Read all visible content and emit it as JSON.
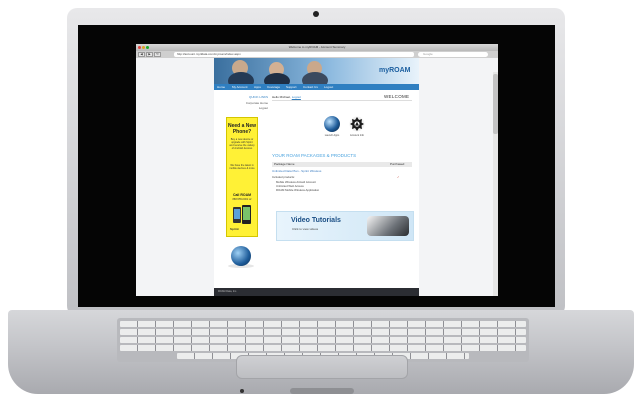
{
  "browser": {
    "window_title": "Welcome to myROAM - Account Summary",
    "url": "http://account.myrldata.com/myroam/index.aspx",
    "search_placeholder": "Google",
    "nav_back": "◀",
    "nav_forward": "▶",
    "nav_reload": "↻"
  },
  "site": {
    "logo": "myROAM",
    "nav": [
      "Home",
      "My Account",
      "Apps",
      "Coverage",
      "Support",
      "Contact Us",
      "Logout"
    ],
    "quick_links_title": "QUICK LINKS",
    "quick_links": [
      "Corporate Home",
      "Logout"
    ],
    "greeting": "Hello Michael,",
    "greeting_link": "Logout",
    "welcome": "WELCOME",
    "icons": [
      {
        "name": "launch-apps-icon",
        "label": "Launch Apps"
      },
      {
        "name": "account-info-icon",
        "label": "Account Info"
      }
    ],
    "packages_title": "YOUR ROAM PACKAGES & PRODUCTS",
    "packages_table": {
      "headers": [
        "Package Name",
        "Purchased"
      ],
      "row_label": "Unlimited Data Plan - Sprint Wireless",
      "included_title": "Included products:",
      "included": [
        "Mobile Wireless Aircard Account",
        "Unlimited Web Access",
        "ROAM Mobile Wireless Application"
      ]
    },
    "banner": {
      "title": "Video Tutorials",
      "subtitle": "Click to view videos"
    },
    "promo": {
      "title": "Need a New Phone?",
      "body1": "Buy a new device or upgrade with Sprint and receive the variety of Android devices",
      "body2": "We have the latest in mobile devices & more",
      "call": "Call ROAM",
      "phone": "888-555-0001 x2",
      "brand": "Sprint"
    },
    "footer": "ROAM Data, Inc."
  },
  "colors": {
    "accent": "#2f7fc1",
    "promo": "#fff136",
    "title_blue": "#4aa3df"
  }
}
